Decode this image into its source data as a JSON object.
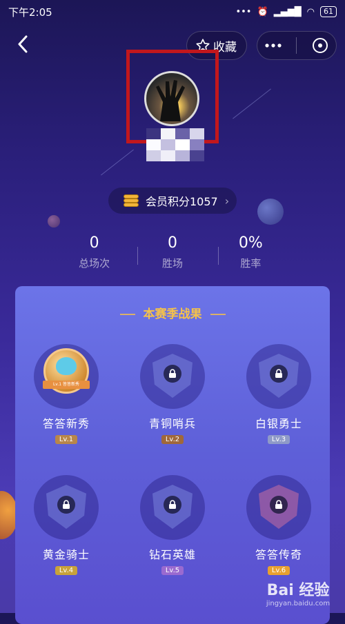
{
  "status_bar": {
    "time": "下午2:05",
    "battery": "61"
  },
  "header": {
    "favorite_label": "收藏"
  },
  "points": {
    "label": "会员积分1057",
    "chevron": "›"
  },
  "stats": [
    {
      "value": "0",
      "label": "总场次"
    },
    {
      "value": "0",
      "label": "胜场"
    },
    {
      "value": "0%",
      "label": "胜率"
    }
  ],
  "season": {
    "title": "本赛季战果",
    "badges": [
      {
        "name": "答答新秀",
        "level": "Lv.1",
        "unlocked": true,
        "level_color": "#b8864a"
      },
      {
        "name": "青铜哨兵",
        "level": "Lv.2",
        "unlocked": false,
        "level_color": "#a0683a"
      },
      {
        "name": "白银勇士",
        "level": "Lv.3",
        "unlocked": false,
        "level_color": "#8f9ac8"
      },
      {
        "name": "黄金骑士",
        "level": "Lv.4",
        "unlocked": false,
        "level_color": "#c8a23a"
      },
      {
        "name": "钻石英雄",
        "level": "Lv.5",
        "unlocked": false,
        "level_color": "#9a6ad0"
      },
      {
        "name": "答答传奇",
        "level": "Lv.6",
        "unlocked": false,
        "level_color": "#e8a030"
      }
    ],
    "medal_ribbon": "Lv.1 答答新秀"
  },
  "watermark": {
    "brand": "Bai 经验",
    "sub": "jingyan.baidu.com"
  }
}
